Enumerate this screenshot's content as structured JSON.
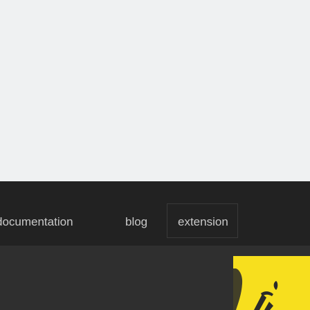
{
  "nav": {
    "items": [
      {
        "label": "documentation"
      },
      {
        "label": "blog"
      },
      {
        "label": "extension"
      }
    ]
  },
  "colors": {
    "header_bg": "#eff1f2",
    "nav_bg": "#222222",
    "nav_text": "#c9c9c9",
    "content_bg": "#2f2f2f",
    "logo_yellow": "#f7df1e"
  },
  "icons": {
    "logo": "yellow-logo-icon"
  }
}
